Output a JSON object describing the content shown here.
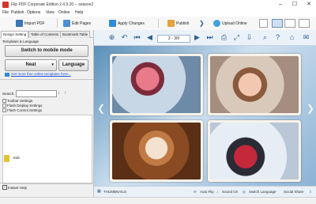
{
  "window": {
    "title": "Flip PDF Corporate Edition 2.4.9.20 -- season2"
  },
  "menu": [
    "File",
    "Publish",
    "Options",
    "View",
    "Online",
    "Help"
  ],
  "toolbar": {
    "import": "Import PDF",
    "edit": "Edit Pages",
    "apply": "Apply Changes",
    "publish": "Publish",
    "upload": "Upload Online"
  },
  "left": {
    "tabs": [
      "Design Setting",
      "Table of Contents",
      "Bookmark Table"
    ],
    "templates_label": "Templates & Language",
    "mobile_button": "Switch to mobile mode",
    "template_name": "Neat",
    "language_button": "Language",
    "more_templates": "Get more free online templates here...",
    "search_label": "Search:",
    "tree": [
      "Toolbar Settings",
      "Flash Display Settings",
      "Flash Control Settings"
    ],
    "edit_label": "Edit",
    "instant_help": "Instant Help"
  },
  "viewer": {
    "page_indicator": "2 - 3/9",
    "thumbnails": "THUMBNAILS",
    "auto_flip": "Auto Flip",
    "sound_on": "Sound On",
    "switch_language": "Switch Language",
    "social_share": "Social Share"
  },
  "colors": {
    "accent": "#2f5f8f",
    "book_bg": "#5a8fb8",
    "frame": "#f7f2ea"
  }
}
